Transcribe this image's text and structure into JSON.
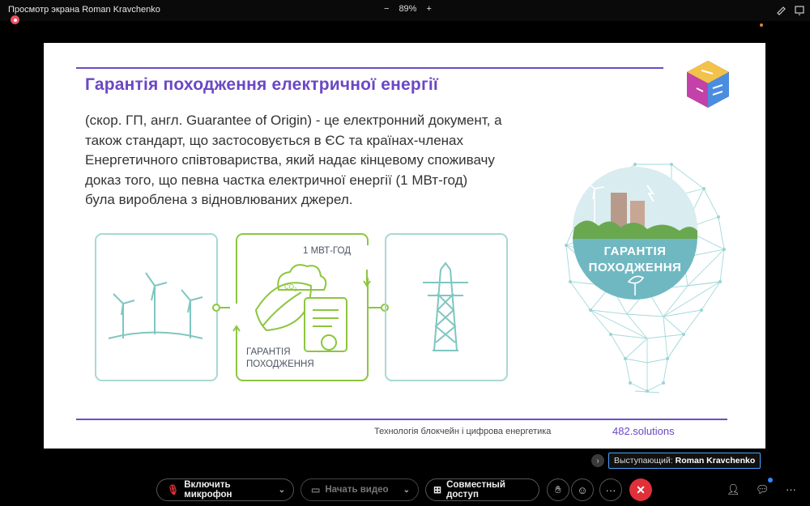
{
  "window": {
    "title": "Просмотр экрана Roman Kravchenko",
    "zoom_minus": "−",
    "zoom_level": "89%",
    "zoom_plus": "+"
  },
  "slide": {
    "heading": "Гарантія походження електричної енергії",
    "body_lines": [
      "(скор. ГП, англ. Guarantee of Origin) - це електронний документ, а",
      "також стандарт, що застосовується  в ЄС та країнах-членах",
      "Енергетичного співтовариства, який надає кінцевому споживачу",
      "доказ того, що певна частка електричної енергії (1 МВт-год)",
      "була вироблена з відновлюваних джерел."
    ],
    "diagram": {
      "mwh_label": "1 МВТ-ГОД",
      "co2_label": "CO",
      "co2_sub": "2",
      "guarantee_label_1": "ГАРАНТІЯ",
      "guarantee_label_2": "ПОХОДЖЕННЯ"
    },
    "bulb_label_1": "ГАРАНТІЯ",
    "bulb_label_2": "ПОХОДЖЕННЯ",
    "footer": "Технологія блокчейн і цифрова енергетика",
    "brand": "482.solutions",
    "colors": {
      "accent": "#6b47c5",
      "green": "#8cc63f",
      "teal": "#a8d8d4"
    }
  },
  "presenter": {
    "prefix": "Выступающий:",
    "name": "Roman Kravchenko"
  },
  "controls": {
    "mic_label": "Включить микрофон",
    "video_label": "Начать видео",
    "share_label": "Совместный доступ",
    "more_label": "···",
    "side_more": "···"
  }
}
